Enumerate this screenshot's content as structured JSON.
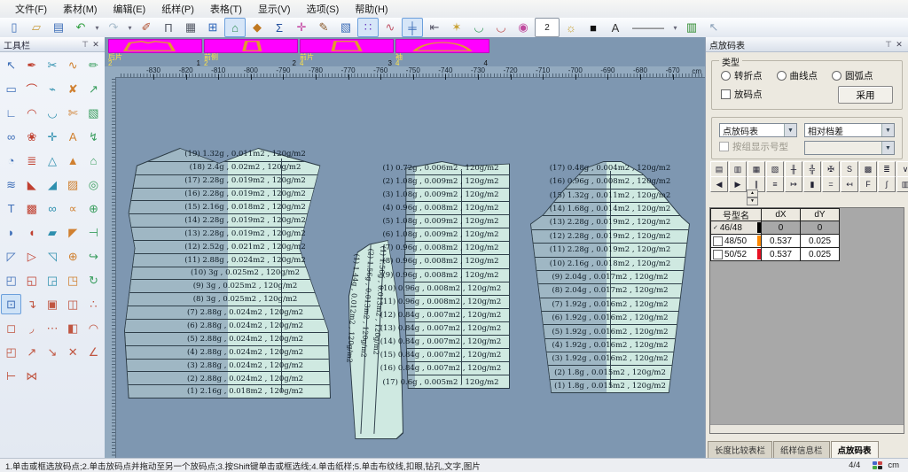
{
  "menu": {
    "items": [
      "文件(F)",
      "素材(M)",
      "编辑(E)",
      "纸样(P)",
      "表格(T)",
      "显示(V)",
      "选项(S)",
      "帮助(H)"
    ]
  },
  "toolbar": {
    "buttons": [
      {
        "name": "new-file",
        "glyph": "▯",
        "color": "#3f6fb8"
      },
      {
        "name": "open-file",
        "glyph": "▱",
        "color": "#c89a3a"
      },
      {
        "name": "save",
        "glyph": "▤",
        "color": "#3f6fb8"
      },
      {
        "name": "undo",
        "glyph": "↶",
        "color": "#2f9e3f"
      },
      {
        "name": "undo-more",
        "glyph": "▾",
        "narrow": true
      },
      {
        "name": "redo",
        "glyph": "↷",
        "color": "#a8bccb"
      },
      {
        "name": "redo-more",
        "glyph": "▾",
        "narrow": true
      },
      {
        "name": "eraser",
        "glyph": "✐",
        "color": "#b05030"
      },
      {
        "name": "pattern-stand",
        "glyph": "Π",
        "color": "#555a66"
      },
      {
        "name": "size-table",
        "glyph": "▦",
        "color": "#555a66"
      },
      {
        "name": "work-window",
        "glyph": "⊞",
        "color": "#2a63b8"
      },
      {
        "name": "show-pattern-piece",
        "glyph": "⌂",
        "color": "#2e8b4f",
        "selected": true
      },
      {
        "name": "color-lock",
        "glyph": "◆",
        "color": "#c07820"
      },
      {
        "name": "sum-sigma",
        "glyph": "Σ",
        "color": "#24509e"
      },
      {
        "name": "align-cross",
        "glyph": "✛",
        "color": "#c23e9e"
      },
      {
        "name": "brush",
        "glyph": "✎",
        "color": "#8a5a2a"
      },
      {
        "name": "flow-chart",
        "glyph": "▧",
        "color": "#3f6fb8"
      },
      {
        "name": "point-grading",
        "glyph": "∷",
        "color": "#6a3ac0",
        "selected": true
      },
      {
        "name": "curve-chart",
        "glyph": "∿",
        "color": "#c05568"
      },
      {
        "name": "measure-tool",
        "glyph": "╪",
        "color": "#3f6fb8",
        "selected": true
      },
      {
        "name": "measure-sum",
        "glyph": "⇤",
        "color": "#556"
      },
      {
        "name": "star-point",
        "glyph": "✶",
        "color": "#c8a030"
      },
      {
        "name": "seam-check-green",
        "glyph": "◡",
        "color": "#3a9e5f"
      },
      {
        "name": "seam-check-red",
        "glyph": "◡",
        "color": "#c04a4a"
      },
      {
        "name": "color-wheel",
        "glyph": "◉",
        "color": "#c04a9e"
      },
      {
        "name": "pen-width-box",
        "glyph": "2",
        "box": true,
        "color": "#222"
      },
      {
        "name": "show-bulb",
        "glyph": "☼",
        "color": "#c8a030"
      },
      {
        "name": "color-swatch",
        "glyph": "■",
        "color": "#111"
      },
      {
        "name": "text-tool",
        "glyph": "A",
        "color": "#333"
      },
      {
        "name": "line-style",
        "glyph": "———",
        "wide": true,
        "color": "#333"
      },
      {
        "name": "line-style-more",
        "glyph": "▾",
        "narrow": true
      },
      {
        "name": "animation-film",
        "glyph": "▥",
        "color": "#2e8b2e"
      },
      {
        "name": "context-help",
        "glyph": "↖",
        "color": "#8aa0b8"
      }
    ]
  },
  "tool_panel": {
    "title": "工具栏",
    "selected_index": 50,
    "tools": [
      "↖",
      "✒",
      "✂",
      "∿",
      "✏",
      "▭",
      "⌒",
      "⌁",
      "✘",
      "↗",
      "∟",
      "◠",
      "◡",
      "✄",
      "▧",
      "∞",
      "❀",
      "✛",
      "Α",
      "↯",
      "◔",
      "≣",
      "△",
      "▲",
      "⌂",
      "≋",
      "◣",
      "◢",
      "▨",
      "◎",
      "T",
      "▩",
      "∞",
      "∝",
      "⊕",
      "◗",
      "◖",
      "▰",
      "◤",
      "⊣",
      "◸",
      "▷",
      "◹",
      "⊕",
      "↪",
      "◰",
      "◱",
      "◲",
      "◳",
      "↻",
      "⊡",
      "↴",
      "▣",
      "◫",
      "∴",
      "◻",
      "◞",
      "⋯",
      "◧",
      "◠",
      "◰",
      "↗",
      "↘",
      "✕",
      "∠",
      "⊢",
      "⋈"
    ]
  },
  "thumbnails": {
    "slots": [
      {
        "label": "后片",
        "count": "2",
        "order": "1"
      },
      {
        "label": "前侧",
        "count": "2",
        "order": "2"
      },
      {
        "label": "前片",
        "count": "4",
        "order": "3"
      },
      {
        "label": "袖",
        "count": "4",
        "order": "4"
      }
    ]
  },
  "ruler": {
    "unit": "cm",
    "ticks": [
      "-830",
      "-820",
      "-810",
      "-800",
      "-790",
      "-780",
      "-770",
      "-760",
      "-750",
      "-740",
      "-730",
      "-720",
      "-710",
      "-700",
      "-690",
      "-680",
      "-670"
    ]
  },
  "canvas": {
    "pieces": [
      {
        "name": "后片",
        "labels": [
          "(19) 1.32g , 0.011m2 , 120g/m2",
          "(18) 2.4g , 0.02m2 , 120g/m2",
          "(17) 2.28g , 0.019m2 , 120g/m2",
          "(16) 2.28g , 0.019m2 , 120g/m2",
          "(15) 2.16g , 0.018m2 , 120g/m2",
          "(14) 2.28g , 0.019m2 , 120g/m2",
          "(13) 2.28g , 0.019m2 , 120g/m2",
          "(12) 2.52g , 0.021m2 , 120g/m2",
          "(11) 2.88g , 0.024m2 , 120g/m2",
          "(10) 3g , 0.025m2 , 120g/m2",
          "(9) 3g , 0.025m2 , 120g/m2",
          "(8) 3g , 0.025m2 , 120g/m2",
          "(7) 2.88g , 0.024m2 , 120g/m2",
          "(6) 2.88g , 0.024m2 , 120g/m2",
          "(5) 2.88g , 0.024m2 , 120g/m2",
          "(4) 2.88g , 0.024m2 , 120g/m2",
          "(3) 2.88g , 0.024m2 , 120g/m2",
          "(2) 2.88g , 0.024m2 , 120g/m2",
          "(1) 2.16g , 0.018m2 , 120g/m2"
        ]
      },
      {
        "name": "前侧",
        "rotated_labels": [
          "(1) 1.44g , 0.012m2 , 120g/m2",
          "(2) 1.56g , 0.013m2 , 120g/m2",
          "(1) 1.56g , 0.013m2 , 120g/m2"
        ]
      },
      {
        "name": "前片",
        "labels": [
          "(1) 0.72g , 0.006m2 , 120g/m2",
          "(2) 1.08g , 0.009m2 , 120g/m2",
          "(3) 1.08g , 0.009m2 , 120g/m2",
          "(4) 0.96g , 0.008m2 , 120g/m2",
          "(5) 1.08g , 0.009m2 , 120g/m2",
          "(6) 1.08g , 0.009m2 , 120g/m2",
          "(7) 0.96g , 0.008m2 , 120g/m2",
          "(8) 0.96g , 0.008m2 , 120g/m2",
          "(9) 0.96g , 0.008m2 , 120g/m2",
          "(10) 0.96g , 0.008m2 , 120g/m2",
          "(11) 0.96g , 0.008m2 , 120g/m2",
          "(12) 0.84g , 0.007m2 , 120g/m2",
          "(13) 0.84g , 0.007m2 , 120g/m2",
          "(14) 0.84g , 0.007m2 , 120g/m2",
          "(15) 0.84g , 0.007m2 , 120g/m2",
          "(16) 0.84g , 0.007m2 , 120g/m2",
          "(17) 0.6g , 0.005m2 , 120g/m2"
        ]
      },
      {
        "name": "袖",
        "labels": [
          "(17) 0.48g , 0.004m2 , 120g/m2",
          "(16) 0.96g , 0.008m2 , 120g/m2",
          "(15) 1.32g , 0.011m2 , 120g/m2",
          "(14) 1.68g , 0.014m2 , 120g/m2",
          "(13) 2.28g , 0.019m2 , 120g/m2",
          "(12) 2.28g , 0.019m2 , 120g/m2",
          "(11) 2.28g , 0.019m2 , 120g/m2",
          "(10) 2.16g , 0.018m2 , 120g/m2",
          "(9) 2.04g , 0.017m2 , 120g/m2",
          "(8) 2.04g , 0.017m2 , 120g/m2",
          "(7) 1.92g , 0.016m2 , 120g/m2",
          "(6) 1.92g , 0.016m2 , 120g/m2",
          "(5) 1.92g , 0.016m2 , 120g/m2",
          "(4) 1.92g , 0.016m2 , 120g/m2",
          "(3) 1.92g , 0.016m2 , 120g/m2",
          "(2) 1.8g , 0.015m2 , 120g/m2",
          "(1) 1.8g , 0.015m2 , 120g/m2"
        ]
      }
    ]
  },
  "grading_panel": {
    "title": "点放码表",
    "type_group": {
      "legend": "类型",
      "radios": [
        "转折点",
        "曲线点",
        "圆弧点"
      ],
      "checkbox": "放码点",
      "apply_button": "采用"
    },
    "view_group": {
      "dropdown1": "点放码表",
      "dropdown2": "相对档差",
      "group_checkbox": "按组显示号型"
    },
    "toolbar_row1": [
      {
        "name": "copy-grading",
        "glyph": "▤"
      },
      {
        "name": "paste-grading",
        "glyph": "▥"
      },
      {
        "name": "paste-x",
        "glyph": "▦"
      },
      {
        "name": "paste-y",
        "glyph": "▧"
      },
      {
        "name": "swap-xy",
        "glyph": "╫"
      },
      {
        "name": "mirror-x",
        "glyph": "╬"
      },
      {
        "name": "mirror-y",
        "glyph": "✠"
      },
      {
        "name": "sl-mode",
        "glyph": "S"
      },
      {
        "name": "clear-grid",
        "glyph": "▩"
      },
      {
        "name": "color-list",
        "glyph": "≣"
      },
      {
        "name": "more-dropdown",
        "glyph": "∨"
      }
    ],
    "toolbar_row2": [
      {
        "name": "prev-point",
        "glyph": "◀"
      },
      {
        "name": "next-point",
        "glyph": "▶"
      },
      {
        "name": "even-x",
        "glyph": "∥"
      },
      {
        "name": "even-y",
        "glyph": "≡"
      },
      {
        "name": "push-right",
        "glyph": "↦"
      },
      {
        "name": "pause-pair",
        "glyph": "▮"
      },
      {
        "name": "equalize",
        "glyph": "="
      },
      {
        "name": "push-left",
        "glyph": "↤"
      },
      {
        "name": "fx-rule",
        "glyph": "F"
      },
      {
        "name": "shrink-rule",
        "glyph": "∫"
      },
      {
        "name": "grid-display",
        "glyph": "▥"
      },
      {
        "name": "point-rule",
        "glyph": "✥",
        "selected": true
      }
    ],
    "table": {
      "headers": [
        "号型名",
        "dX",
        "dY"
      ],
      "rows": [
        {
          "marker": "✓",
          "name": "46/48",
          "dx": "0",
          "dy": "0",
          "swatch": "#000000",
          "selected": true
        },
        {
          "checkbox": true,
          "name": "48/50",
          "dx": "0.537",
          "dy": "0.025",
          "swatch": "#ff8a00"
        },
        {
          "checkbox": true,
          "name": "50/52",
          "dx": "0.537",
          "dy": "0.025",
          "swatch": "#e81123"
        }
      ]
    },
    "tabs": [
      {
        "label": "长度比较表栏"
      },
      {
        "label": "纸样信息栏"
      },
      {
        "label": "点放码表",
        "active": true
      }
    ]
  },
  "status_bar": {
    "instructions": "1.单击或框选放码点;2.单击放码点并拖动至另一个放码点;3.按Shift键单击或框选线;4.单击纸样;5.单击布纹线,扣眼,钻孔,文字,图片",
    "page": "4/4",
    "unit": "cm"
  }
}
